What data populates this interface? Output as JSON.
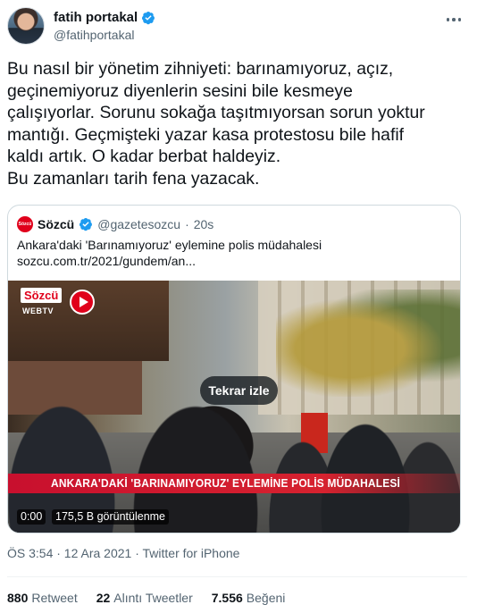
{
  "author": {
    "display_name": "fatih portakal",
    "handle": "@fatihportakal",
    "verified": true,
    "avatar": "profile-photo"
  },
  "tweet": {
    "text_lines": [
      "Bu nasıl bir yönetim zihniyeti: barınamıyoruz, açız,",
      "geçinemiyoruz diyenlerin sesini bile kesmeye",
      "çalışıyorlar. Sorunu sokağa taşıtmıyorsan sorun yoktur",
      "mantığı. Geçmişteki yazar kasa protestosu bile hafif",
      "kaldı artık. O kadar berbat haldeyiz.",
      "Bu zamanları tarih fena yazacak."
    ]
  },
  "quote": {
    "logo_text": "Sözcü",
    "display_name": "Sözcü",
    "handle": "@gazetesozcu",
    "separator": "·",
    "time": "20s",
    "text": "Ankara'daki 'Barınamıyoruz' eylemine polis müdahalesi",
    "link": "sozcu.com.tr/2021/gundem/an...",
    "video": {
      "channel_brand": "Sözcü",
      "channel_sub": "WEBTV",
      "replay_label": "Tekrar izle",
      "banner_text": "ANKARA'DAKİ 'BARINAMIYORUZ' EYLEMİNE POLİS MÜDAHALESİ",
      "time": "0:00",
      "views": "175,5 B görüntülenme"
    }
  },
  "meta": {
    "text": "ÖS 3:54 · 12 Ara 2021 · Twitter for iPhone"
  },
  "stats": {
    "retweets_count": "880",
    "retweets_label": "Retweet",
    "quotes_count": "22",
    "quotes_label": "Alıntı Tweetler",
    "likes_count": "7.556",
    "likes_label": "Beğeni"
  },
  "colors": {
    "verified_blue": "#1d9bf0",
    "sozcu_red": "#e0001b",
    "secondary_text": "#536471",
    "primary_text": "#0f1419"
  }
}
